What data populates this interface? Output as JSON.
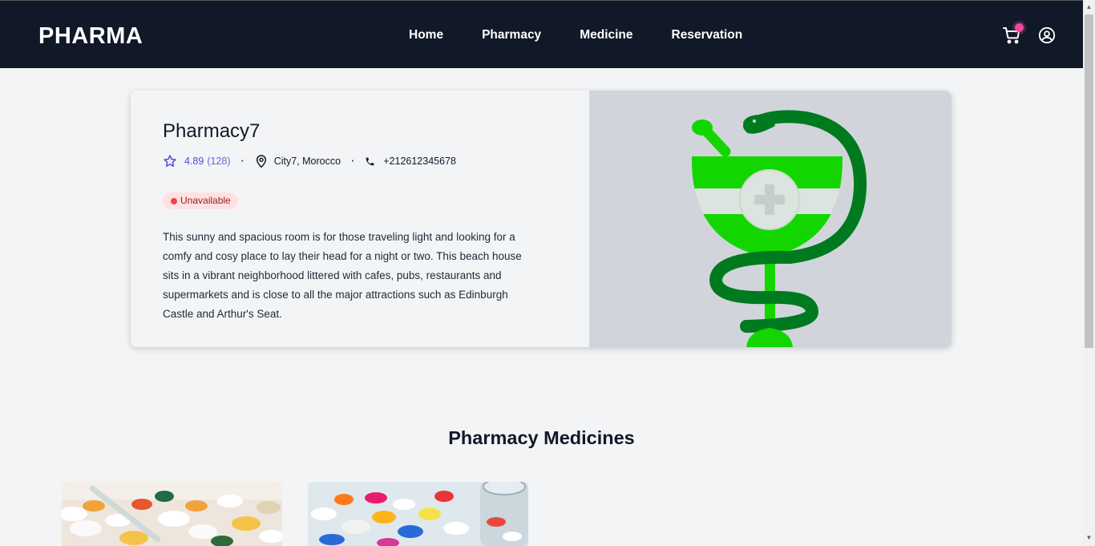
{
  "header": {
    "logo": "PHARMA",
    "nav": [
      "Home",
      "Pharmacy",
      "Medicine",
      "Reservation"
    ],
    "cart_icon": "cart-icon",
    "user_icon": "user-circle-icon",
    "cart_badge_color": "#ec4899"
  },
  "pharmacy": {
    "name": "Pharmacy7",
    "rating": "4.89",
    "reviews": "(128)",
    "location": "City7, Morocco",
    "phone": "+212612345678",
    "status": "Unavailable",
    "description": "This sunny and spacious room is for those traveling light and looking for a comfy and cosy place to lay their head for a night or two. This beach house sits in a vibrant neighborhood littered with cafes, pubs, restaurants and supermarkets and is close to all the major attractions such as Edinburgh Castle and Arthur's Seat.",
    "image_icon": "pharmacy-caduceus-icon"
  },
  "medicines": {
    "title": "Pharmacy Medicines",
    "items": [
      {
        "image": "pills-image"
      },
      {
        "image": "pills-bottle-image"
      }
    ]
  },
  "colors": {
    "nav_bg": "#111827",
    "accent": "#4f46e5",
    "status_bg": "#fee2e2",
    "status_text": "#991b1b",
    "logo_green": "#13d600",
    "logo_dark_green": "#007a1e"
  }
}
